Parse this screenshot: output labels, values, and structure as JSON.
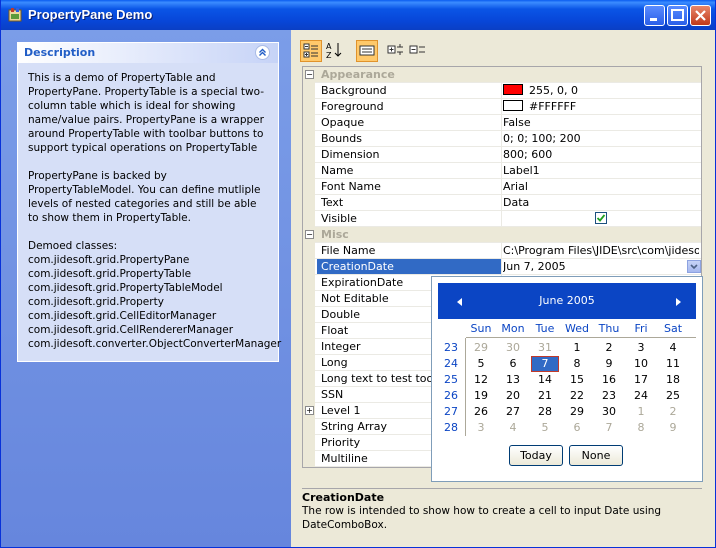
{
  "window": {
    "title": "PropertyPane Demo"
  },
  "description_panel": {
    "title": "Description",
    "paragraphs": [
      "This is a demo of PropertyTable and PropertyPane. PropertyTable is a special two-column table which is ideal for showing name/value pairs. PropertyPane is a wrapper around PropertyTable with toolbar buttons to support typical operations on PropertyTable",
      "PropertyPane is backed by PropertyTableModel. You can define mutliple levels of nested categories and still be able to show them in PropertyTable.",
      "Demoed classes:"
    ],
    "classes": [
      "com.jidesoft.grid.PropertyPane",
      "com.jidesoft.grid.PropertyTable",
      "com.jidesoft.grid.PropertyTableModel",
      "com.jidesoft.grid.Property",
      "com.jidesoft.grid.CellEditorManager",
      "com.jidesoft.grid.CellRendererManager",
      "com.jidesoft.converter.ObjectConverterManager"
    ]
  },
  "toolbar": {
    "icons": [
      "categorized-view-icon",
      "sort-alphabetical-icon",
      "description-toggle-icon",
      "expand-all-icon",
      "collapse-all-icon"
    ]
  },
  "table": {
    "rows": [
      {
        "type": "category",
        "name": "Appearance",
        "expander": "−"
      },
      {
        "type": "prop",
        "name": "Background",
        "value": "255, 0, 0",
        "swatch": "#ff0000"
      },
      {
        "type": "prop",
        "name": "Foreground",
        "value": "#FFFFFF",
        "swatch": "#ffffff"
      },
      {
        "type": "prop",
        "name": "Opaque",
        "value": "False"
      },
      {
        "type": "prop",
        "name": "Bounds",
        "value": "0; 0; 100; 200"
      },
      {
        "type": "prop",
        "name": "Dimension",
        "value": "800; 600"
      },
      {
        "type": "prop",
        "name": "Name",
        "value": "Label1"
      },
      {
        "type": "prop",
        "name": "Font Name",
        "value": "Arial"
      },
      {
        "type": "prop",
        "name": "Text",
        "value": "Data"
      },
      {
        "type": "prop",
        "name": "Visible",
        "value": "",
        "check": true
      },
      {
        "type": "category",
        "name": "Misc",
        "expander": "−"
      },
      {
        "type": "prop",
        "name": "File Name",
        "value": "C:\\Program Files\\JIDE\\src\\com\\jidesoft..."
      },
      {
        "type": "prop",
        "name": "CreationDate",
        "value": "Jun 7, 2005",
        "selected": true,
        "combo": true
      },
      {
        "type": "prop",
        "name": "ExpirationDate",
        "value": ""
      },
      {
        "type": "prop",
        "name": "Not Editable",
        "value": ""
      },
      {
        "type": "prop",
        "name": "Double",
        "value": ""
      },
      {
        "type": "prop",
        "name": "Float",
        "value": ""
      },
      {
        "type": "prop",
        "name": "Integer",
        "value": ""
      },
      {
        "type": "prop",
        "name": "Long",
        "value": ""
      },
      {
        "type": "prop",
        "name": "Long text to test tooltip",
        "value": ""
      },
      {
        "type": "prop",
        "name": "SSN",
        "value": ""
      },
      {
        "type": "prop",
        "name": "Level 1",
        "value": "",
        "expander": "+"
      },
      {
        "type": "prop",
        "name": "String Array",
        "value": ""
      },
      {
        "type": "prop",
        "name": "Priority",
        "value": ""
      },
      {
        "type": "prop",
        "name": "Multiline",
        "value": ""
      }
    ]
  },
  "calendar": {
    "month": "June",
    "year": "2005",
    "days_of_week": [
      "Sun",
      "Mon",
      "Tue",
      "Wed",
      "Thu",
      "Fri",
      "Sat"
    ],
    "weeks": [
      {
        "num": "23",
        "days": [
          [
            "29",
            true
          ],
          [
            "30",
            true
          ],
          [
            "31",
            true
          ],
          [
            "1",
            false
          ],
          [
            "2",
            false
          ],
          [
            "3",
            false
          ],
          [
            "4",
            false
          ]
        ]
      },
      {
        "num": "24",
        "days": [
          [
            "5",
            false
          ],
          [
            "6",
            false
          ],
          [
            "7",
            false,
            true
          ],
          [
            "8",
            false
          ],
          [
            "9",
            false
          ],
          [
            "10",
            false
          ],
          [
            "11",
            false
          ]
        ]
      },
      {
        "num": "25",
        "days": [
          [
            "12",
            false
          ],
          [
            "13",
            false
          ],
          [
            "14",
            false
          ],
          [
            "15",
            false
          ],
          [
            "16",
            false
          ],
          [
            "17",
            false
          ],
          [
            "18",
            false
          ]
        ]
      },
      {
        "num": "26",
        "days": [
          [
            "19",
            false
          ],
          [
            "20",
            false
          ],
          [
            "21",
            false
          ],
          [
            "22",
            false
          ],
          [
            "23",
            false
          ],
          [
            "24",
            false
          ],
          [
            "25",
            false
          ]
        ]
      },
      {
        "num": "27",
        "days": [
          [
            "26",
            false
          ],
          [
            "27",
            false
          ],
          [
            "28",
            false
          ],
          [
            "29",
            false
          ],
          [
            "30",
            false
          ],
          [
            "1",
            true
          ],
          [
            "2",
            true
          ]
        ]
      },
      {
        "num": "28",
        "days": [
          [
            "3",
            true
          ],
          [
            "4",
            true
          ],
          [
            "5",
            true
          ],
          [
            "6",
            true
          ],
          [
            "7",
            true
          ],
          [
            "8",
            true
          ],
          [
            "9",
            true
          ]
        ]
      }
    ],
    "today_label": "Today",
    "none_label": "None"
  },
  "description_box": {
    "title": "CreationDate",
    "text": "The row is intended to show how to create a cell to input Date using DateComboBox."
  }
}
